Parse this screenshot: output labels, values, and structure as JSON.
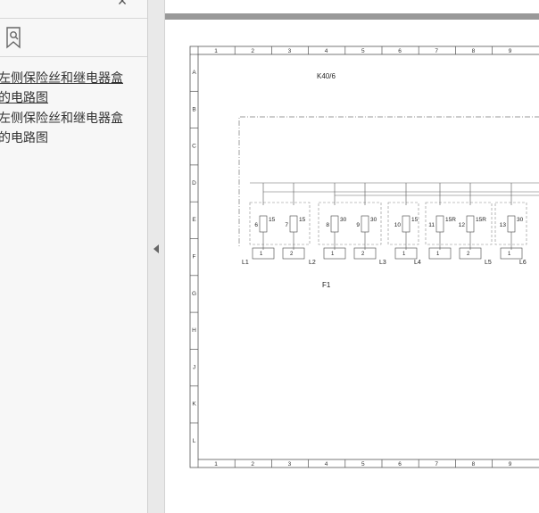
{
  "sidebar": {
    "close_glyph": "×",
    "bookmark_icon": "bookmark-search-icon",
    "items": [
      {
        "line1": "左侧保险丝和继电器盒",
        "line2": "的电路图"
      },
      {
        "line1": "左侧保险丝和继电器盒",
        "line2": "的电路图"
      }
    ]
  },
  "diagram": {
    "sheet_ref": "K40/6",
    "block_label": "F1",
    "columns": [
      "1",
      "2",
      "3",
      "4",
      "5",
      "6",
      "7",
      "8",
      "9"
    ],
    "rows": [
      "A",
      "B",
      "C",
      "D",
      "E",
      "F",
      "G",
      "H",
      "J",
      "K",
      "L"
    ],
    "fuses": [
      {
        "num": "6",
        "rating": "15"
      },
      {
        "num": "7",
        "rating": "15"
      },
      {
        "num": "8",
        "rating": "30"
      },
      {
        "num": "9",
        "rating": "30"
      },
      {
        "num": "10",
        "rating": "15"
      },
      {
        "num": "11",
        "rating": "15R"
      },
      {
        "num": "12",
        "rating": "15R"
      },
      {
        "num": "13",
        "rating": "30"
      }
    ],
    "pin_labels": [
      "1",
      "2",
      "1",
      "2",
      "1",
      "1",
      "2",
      "1"
    ],
    "connectors": [
      "L1",
      "L2",
      "L3",
      "L4",
      "L5",
      "L6"
    ],
    "mini_label": "30"
  }
}
